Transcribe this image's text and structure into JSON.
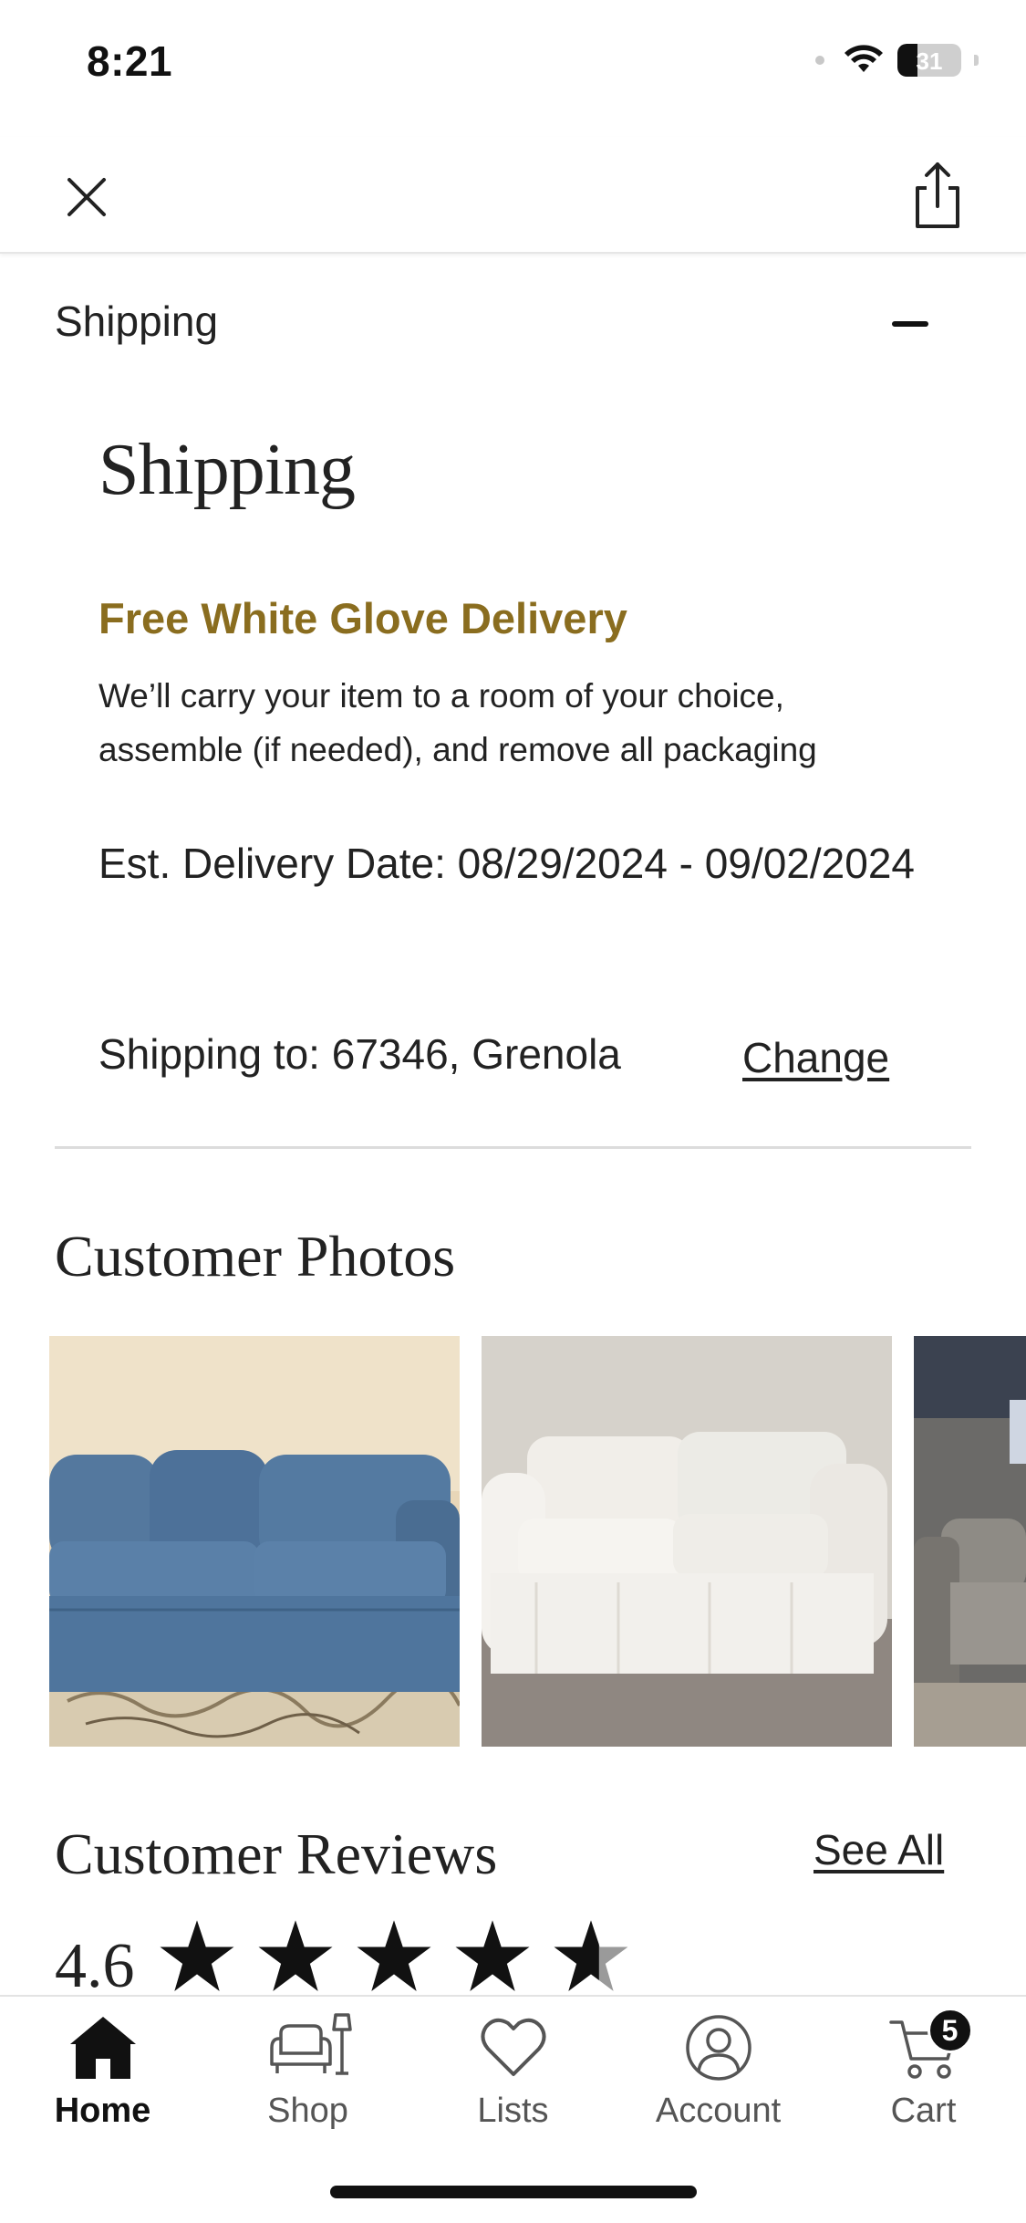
{
  "status_bar": {
    "time": "8:21",
    "battery": "31",
    "battery_level": 0.31
  },
  "accordion": {
    "title": "Shipping"
  },
  "shipping": {
    "heading": "Shipping",
    "white_glove_title": "Free White Glove Delivery",
    "white_glove_desc": "We’ll carry your item to a room of your choice, assemble (if needed), and remove all packaging",
    "est_delivery": "Est. Delivery Date: 08/29/2024 - 09/02/2024",
    "shipping_to": "Shipping to: 67346, Grenola",
    "change_label": "Change"
  },
  "customer_photos": {
    "title": "Customer Photos",
    "photos": [
      {
        "name": "blue-sofa-photo"
      },
      {
        "name": "white-sofa-photo"
      },
      {
        "name": "gray-sofa-photo"
      }
    ]
  },
  "reviews": {
    "title": "Customer Reviews",
    "see_all": "See All",
    "rating": "4.6",
    "rating_value": 4.6,
    "max_stars": 5
  },
  "tabbar": {
    "items": [
      {
        "label": "Home",
        "icon": "home-icon",
        "active": true
      },
      {
        "label": "Shop",
        "icon": "sofa-lamp-icon"
      },
      {
        "label": "Lists",
        "icon": "heart-icon"
      },
      {
        "label": "Account",
        "icon": "account-icon"
      },
      {
        "label": "Cart",
        "icon": "cart-icon",
        "badge": "5"
      }
    ]
  },
  "colors": {
    "accent_gold": "#8a6d1f",
    "text": "#222222",
    "divider": "#dcdcdc"
  }
}
